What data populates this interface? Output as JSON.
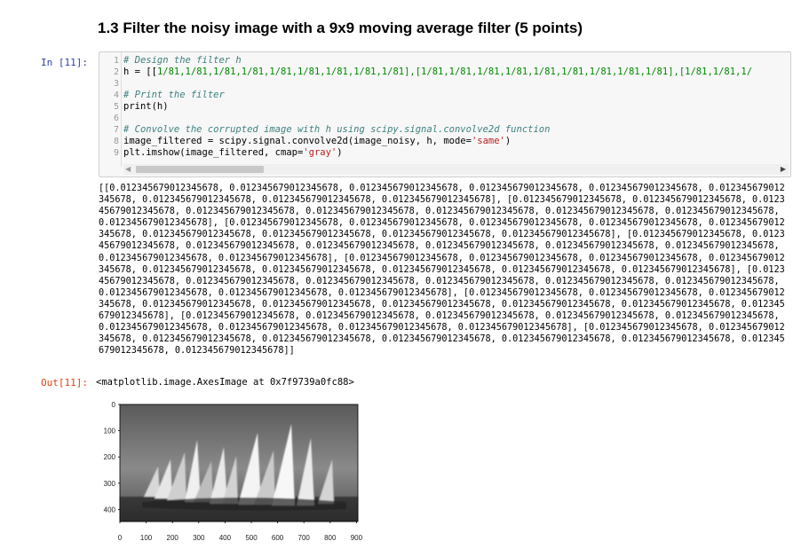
{
  "heading": "1.3 Filter the noisy image with a 9x9 moving average filter (5 points)",
  "cell": {
    "in_prompt": "In [11]:",
    "line_numbers": [
      "1",
      "2",
      "3",
      "4",
      "5",
      "6",
      "7",
      "8",
      "9"
    ],
    "code": {
      "line1": "# Design the filter h",
      "line2_prefix": "h = [[",
      "line2_body": "1/81,1/81,1/81,1/81,1/81,1/81,1/81,1/81,1/81],[1/81,1/81,1/81,1/81,1/81,1/81,1/81,1/81,1/81],[1/81,1/81,1/",
      "line4": "# Print the filter",
      "line5": "print(h)",
      "line7": "# Convolve the corrupted image with h using scipy.signal.convolve2d function",
      "line8_prefix": "image_filtered = scipy.signal.convolve2d(image_noisy, h, mode=",
      "line8_str": "'same'",
      "line8_suffix": ")",
      "line9_prefix": "plt.imshow(image_filtered, cmap=",
      "line9_str": "'gray'",
      "line9_suffix": ")"
    },
    "stdout": "[[0.012345679012345678, 0.012345679012345678, 0.012345679012345678, 0.012345679012345678, 0.012345679012345678, 0.012345679012345678, 0.012345679012345678, 0.012345679012345678, 0.012345679012345678], [0.012345679012345678, 0.012345679012345678, 0.012345679012345678, 0.012345679012345678, 0.012345679012345678, 0.012345679012345678, 0.012345679012345678, 0.012345679012345678, 0.012345679012345678], [0.012345679012345678, 0.012345679012345678, 0.012345679012345678, 0.012345679012345678, 0.012345679012345678, 0.012345679012345678, 0.012345679012345678, 0.012345679012345678, 0.012345679012345678], [0.012345679012345678, 0.012345679012345678, 0.012345679012345678, 0.012345679012345678, 0.012345679012345678, 0.012345679012345678, 0.012345679012345678, 0.012345679012345678, 0.012345679012345678], [0.012345679012345678, 0.012345679012345678, 0.012345679012345678, 0.012345679012345678, 0.012345679012345678, 0.012345679012345678, 0.012345679012345678, 0.012345679012345678, 0.012345679012345678], [0.012345679012345678, 0.012345679012345678, 0.012345679012345678, 0.012345679012345678, 0.012345679012345678, 0.012345679012345678, 0.012345679012345678, 0.012345679012345678, 0.012345679012345678], [0.012345679012345678, 0.012345679012345678, 0.012345679012345678, 0.012345679012345678, 0.012345679012345678, 0.012345679012345678, 0.012345679012345678, 0.012345679012345678, 0.012345679012345678], [0.012345679012345678, 0.012345679012345678, 0.012345679012345678, 0.012345679012345678, 0.012345679012345678, 0.012345679012345678, 0.012345679012345678, 0.012345679012345678, 0.012345679012345678], [0.012345679012345678, 0.012345679012345678, 0.012345679012345678, 0.012345679012345678, 0.012345679012345678, 0.012345679012345678, 0.012345679012345678, 0.012345679012345678, 0.012345679012345678]]",
    "out_prompt": "Out[11]:",
    "out_text": "<matplotlib.image.AxesImage at 0x7f9739a0fc88>"
  },
  "plot": {
    "y_ticks": [
      "0",
      "100",
      "200",
      "300",
      "400"
    ],
    "x_ticks": [
      "0",
      "100",
      "200",
      "300",
      "400",
      "500",
      "600",
      "700",
      "800",
      "900"
    ]
  },
  "colors": {
    "in_prompt": "#303f9f",
    "out_prompt": "#d84315",
    "comment": "#408080",
    "number": "#008800",
    "string": "#ba2121"
  }
}
